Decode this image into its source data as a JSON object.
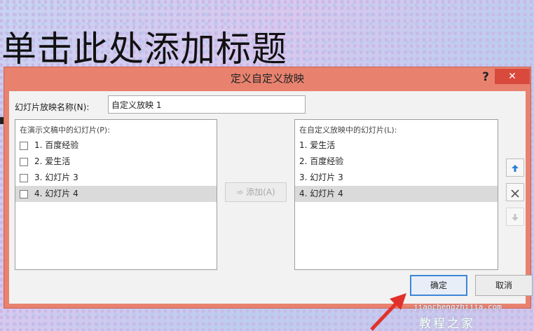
{
  "slide": {
    "title_placeholder": "单击此处添加标题"
  },
  "dialog": {
    "title": "定义自定义放映",
    "help_label": "?",
    "close_label": "✕",
    "name_label": "幻灯片放映名称(N):",
    "name_value": "自定义放映 1",
    "left_list": {
      "caption": "在演示文稿中的幻灯片(P):",
      "items": [
        "1. 百度经验",
        "2. 爱生活",
        "3. 幻灯片 3",
        "4. 幻灯片 4"
      ],
      "selected_index": 3
    },
    "add_button": "➾ 添加(A)",
    "right_list": {
      "caption": "在自定义放映中的幻灯片(L):",
      "items": [
        "1. 爱生活",
        "2. 百度经验",
        "3. 幻灯片 3",
        "4. 幻灯片 4"
      ],
      "selected_index": 3
    },
    "icons": {
      "up": "arrow-up-icon",
      "remove": "close-icon",
      "down": "arrow-down-icon"
    },
    "ok_label": "确定",
    "cancel_label": "取消"
  },
  "watermark": {
    "main": "教程之家",
    "sub": "jiaochengzhijia.com"
  },
  "colors": {
    "dialog_frame": "#e8826f",
    "close_button": "#d94a3c",
    "ok_border": "#3d86d6",
    "arrow": "#e0322b"
  }
}
